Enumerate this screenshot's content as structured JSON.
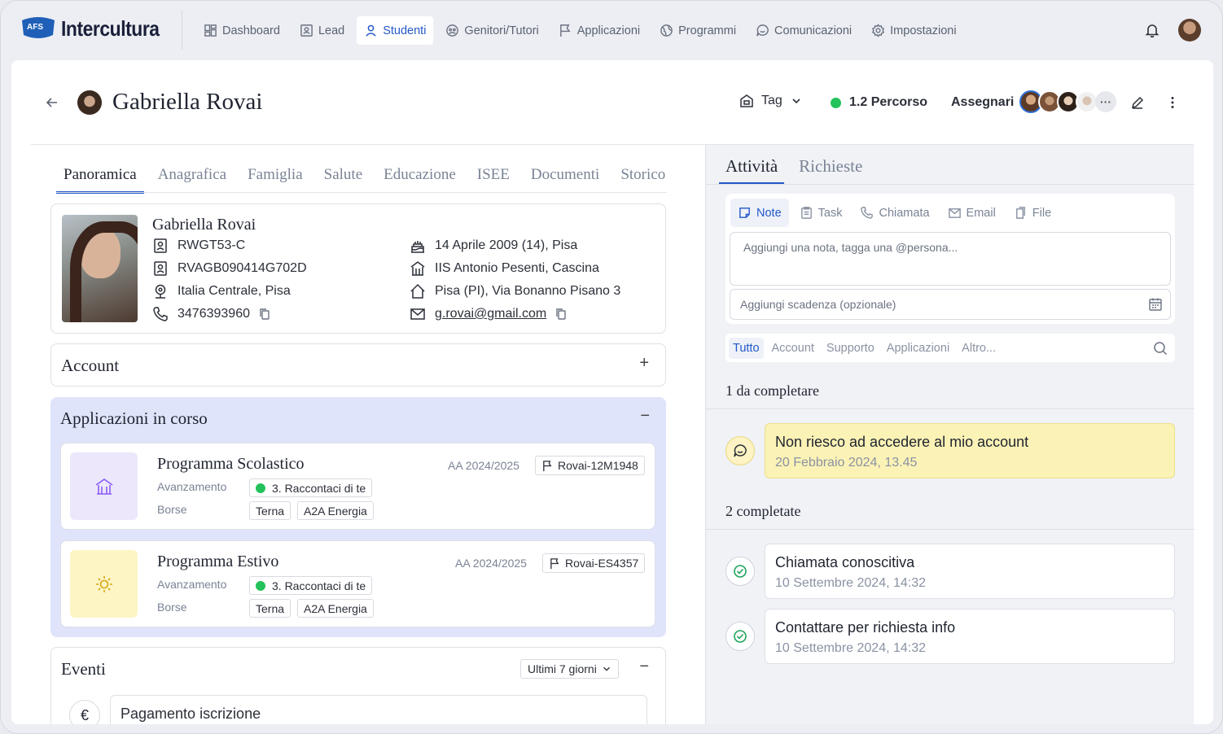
{
  "brand": {
    "name": "Intercultura",
    "badge": "AFS"
  },
  "nav": {
    "items": [
      {
        "label": "Dashboard",
        "icon": "dashboard-icon",
        "active": false
      },
      {
        "label": "Lead",
        "icon": "lead-icon",
        "active": false
      },
      {
        "label": "Studenti",
        "icon": "user-icon",
        "active": true
      },
      {
        "label": "Genitori/Tutori",
        "icon": "family-icon",
        "active": false
      },
      {
        "label": "Applicazioni",
        "icon": "flag-icon",
        "active": false
      },
      {
        "label": "Programmi",
        "icon": "globe-icon",
        "active": false
      },
      {
        "label": "Comunicazioni",
        "icon": "chat-icon",
        "active": false
      },
      {
        "label": "Impostazioni",
        "icon": "gear-icon",
        "active": false
      }
    ]
  },
  "header": {
    "name": "Gabriella Rovai",
    "tag_label": "Tag",
    "status_label": "1.2 Percorso",
    "assign_label": "Assegnari",
    "status_color": "#23c25b",
    "accent": "#2358c9"
  },
  "tabs": [
    "Panoramica",
    "Anagrafica",
    "Famiglia",
    "Salute",
    "Educazione",
    "ISEE",
    "Documenti",
    "Storico"
  ],
  "profile": {
    "name": "Gabriella Rovai",
    "code": "RWGT53-C",
    "fiscal_code": "RVAGB090414G702D",
    "region": "Italia Centrale, Pisa",
    "phone": "3476393960",
    "birth": "14 Aprile 2009 (14), Pisa",
    "school": "IIS Antonio Pesenti, Cascina",
    "address": "Pisa (PI), Via Bonanno Pisano 3",
    "email": "g.rovai@gmail.com"
  },
  "account": {
    "title": "Account",
    "action": "+"
  },
  "applications": {
    "title": "Applicazioni in corso",
    "action": "−",
    "progress_label": "Avanzamento",
    "grants_label": "Borse",
    "items": [
      {
        "title": "Programma Scolastico",
        "year": "AA 2024/2025",
        "code": "Rovai-12M1948",
        "step": "3. Raccontaci di te",
        "grants": [
          "Terna",
          "A2A Energia"
        ]
      },
      {
        "title": "Programma Estivo",
        "year": "AA 2024/2025",
        "code": "Rovai-ES4357",
        "step": "3. Raccontaci di te",
        "grants": [
          "Terna",
          "A2A Energia"
        ]
      }
    ]
  },
  "events": {
    "title": "Eventi",
    "filter": "Ultimi 7 giorni",
    "action": "−",
    "items": [
      {
        "title": "Pagamento iscrizione",
        "icon": "€"
      }
    ]
  },
  "activity": {
    "tabs": [
      "Attività",
      "Richieste"
    ],
    "composer_tabs": [
      "Note",
      "Task",
      "Chiamata",
      "Email",
      "File"
    ],
    "note_placeholder": "Aggiungi una nota, tagga una @persona...",
    "due_placeholder": "Aggiungi scadenza (opzionale)",
    "filters": [
      "Tutto",
      "Account",
      "Supporto",
      "Applicazioni",
      "Altro..."
    ],
    "pending_title": "1 da completare",
    "done_title": "2 completate",
    "pending": [
      {
        "title": "Non riesco ad accedere al mio account",
        "date": "20 Febbraio 2024, 13.45"
      }
    ],
    "done": [
      {
        "title": "Chiamata conoscitiva",
        "date": "10 Settembre 2024, 14:32"
      },
      {
        "title": "Contattare per richiesta info",
        "date": "10 Settembre 2024, 14:32"
      }
    ]
  }
}
